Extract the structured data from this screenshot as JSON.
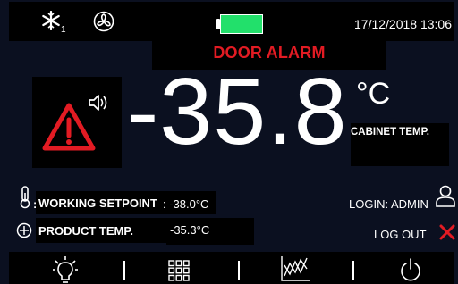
{
  "status_bar": {
    "snowflake_icon": "snowflake-icon",
    "compressor_count": "1",
    "fan_icon": "fan-icon",
    "battery_color": "#22e06b",
    "datetime": "17/12/2018 13:06"
  },
  "alarm": {
    "text": "DOOR ALARM",
    "color": "#e21b23"
  },
  "cabinet": {
    "temperature": "-35.8",
    "unit": "°C",
    "label": "CABINET TEMP."
  },
  "setpoint": {
    "label": "WORKING SETPOINT",
    "separator": ":",
    "value": ": -38.0°C"
  },
  "product": {
    "label": "PRODUCT TEMP.",
    "value": "-35.3°C"
  },
  "user": {
    "login_label": "LOGIN: ADMIN",
    "logout_label": "LOG OUT"
  },
  "bottom_nav": {
    "items": [
      "lightbulb-icon",
      "grid-menu-icon",
      "chart-icon",
      "power-icon"
    ]
  }
}
